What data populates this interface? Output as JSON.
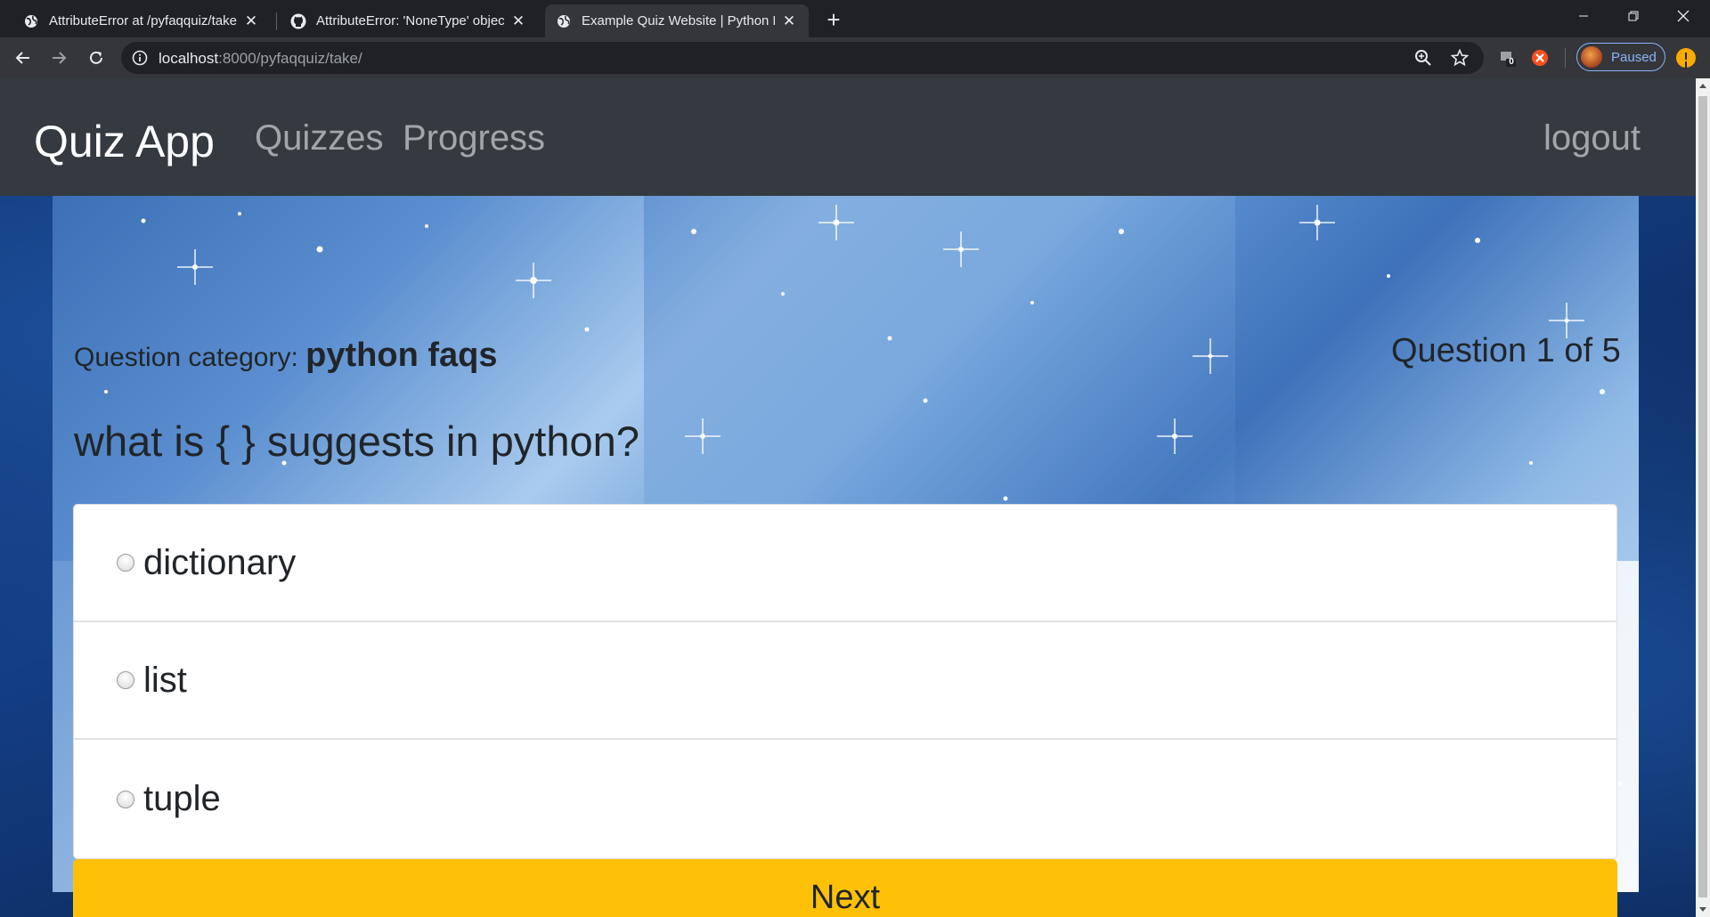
{
  "browser": {
    "tabs": [
      {
        "title": "AttributeError at /pyfaqquiz/take/",
        "favicon": "globe-icon",
        "active": false
      },
      {
        "title": "AttributeError: 'NoneType' object has no attribute",
        "favicon": "github-icon",
        "active": false
      },
      {
        "title": "Example Quiz Website | Python FAQs",
        "favicon": "globe-icon",
        "active": true
      }
    ],
    "url_host": "localhost",
    "url_path": ":8000/pyfaqquiz/take/",
    "extension_badge": "0",
    "profile_label": "Paused"
  },
  "navbar": {
    "brand": "Quiz App",
    "links": [
      "Quizzes",
      "Progress"
    ],
    "logout": "logout"
  },
  "quiz": {
    "category_label": "Question category:",
    "category_name": "python faqs",
    "counter": "Question 1 of 5",
    "question": "what is { } suggests in python?",
    "answers": [
      "dictionary",
      "list",
      "tuple"
    ],
    "next_label": "Next"
  },
  "colors": {
    "navbar_bg": "#343a40",
    "next_button": "#ffc107",
    "chrome_bg": "#202124",
    "toolbar_bg": "#35363a"
  }
}
